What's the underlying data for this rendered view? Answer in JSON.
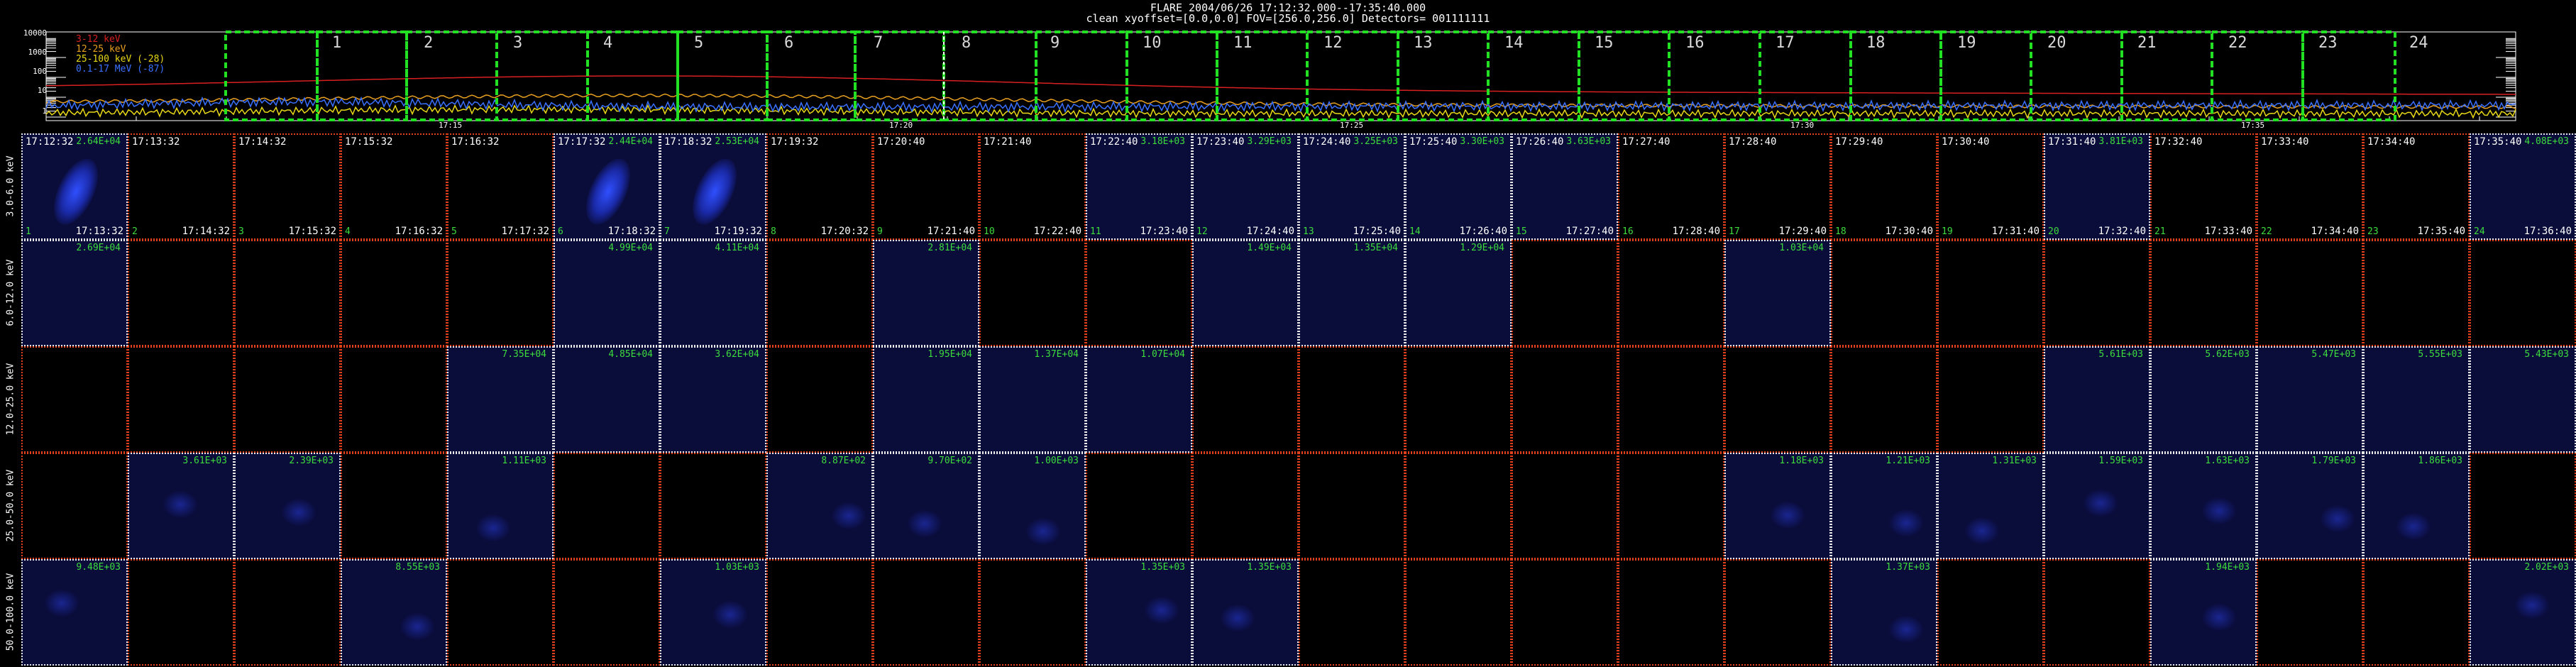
{
  "header": {
    "title": "FLARE 2004/06/26 17:12:32.000--17:35:40.000",
    "info": "clean   xyoffset=[0.0,0.0]   FOV=[256.0,256.0]   Detectors= 001111111"
  },
  "lightcurve": {
    "legend": [
      "3-12 keV",
      "12-25 keV",
      "25-100 keV (-28)",
      "0.1-17 MeV (-87)"
    ],
    "yticks": [
      "10000",
      "1000",
      "100",
      "10",
      "1"
    ],
    "xticks": [
      "17:15",
      "17:20",
      "17:25",
      "17:30",
      "17:35"
    ],
    "bins": [
      "1",
      "2",
      "3",
      "4",
      "5",
      "6",
      "7",
      "8",
      "9",
      "10",
      "11",
      "12",
      "13",
      "14",
      "15",
      "16",
      "17",
      "18",
      "19",
      "20",
      "21",
      "22",
      "23",
      "24"
    ],
    "colors": {
      "c1": "#d82020",
      "c2": "#e8a020",
      "c3": "#e8d818",
      "c4": "#3a70ff",
      "box": "#22e022"
    }
  },
  "energy_bands": [
    "3.0-6.0 keV",
    "6.0-12.0 keV",
    "12.0-25.0 keV",
    "25.0-50.0 keV",
    "50.0-100.0 keV"
  ],
  "columns": [
    {
      "idx": "1",
      "start": "17:12:32",
      "end": "17:13:32"
    },
    {
      "idx": "2",
      "start": "17:13:32",
      "end": "17:14:32"
    },
    {
      "idx": "3",
      "start": "17:14:32",
      "end": "17:15:32"
    },
    {
      "idx": "4",
      "start": "17:15:32",
      "end": "17:16:32"
    },
    {
      "idx": "5",
      "start": "17:16:32",
      "end": "17:17:32"
    },
    {
      "idx": "6",
      "start": "17:17:32",
      "end": "17:18:32"
    },
    {
      "idx": "7",
      "start": "17:18:32",
      "end": "17:19:32"
    },
    {
      "idx": "8",
      "start": "17:19:32",
      "end": "17:20:32"
    },
    {
      "idx": "9",
      "start": "17:20:40",
      "end": "17:21:40"
    },
    {
      "idx": "10",
      "start": "17:21:40",
      "end": "17:22:40"
    },
    {
      "idx": "11",
      "start": "17:22:40",
      "end": "17:23:40"
    },
    {
      "idx": "12",
      "start": "17:23:40",
      "end": "17:24:40"
    },
    {
      "idx": "13",
      "start": "17:24:40",
      "end": "17:25:40"
    },
    {
      "idx": "14",
      "start": "17:25:40",
      "end": "17:26:40"
    },
    {
      "idx": "15",
      "start": "17:26:40",
      "end": "17:27:40"
    },
    {
      "idx": "16",
      "start": "17:27:40",
      "end": "17:28:40"
    },
    {
      "idx": "17",
      "start": "17:28:40",
      "end": "17:29:40"
    },
    {
      "idx": "18",
      "start": "17:29:40",
      "end": "17:30:40"
    },
    {
      "idx": "19",
      "start": "17:30:40",
      "end": "17:31:40"
    },
    {
      "idx": "20",
      "start": "17:31:40",
      "end": "17:32:40"
    },
    {
      "idx": "21",
      "start": "17:32:40",
      "end": "17:33:40"
    },
    {
      "idx": "22",
      "start": "17:33:40",
      "end": "17:34:40"
    },
    {
      "idx": "23",
      "start": "17:34:40",
      "end": "17:35:40"
    },
    {
      "idx": "24",
      "start": "17:35:40",
      "end": "17:36:40"
    }
  ],
  "cells": [
    {
      "row": 0,
      "col": 0,
      "count": "2.64E+04",
      "flare": true
    },
    {
      "row": 0,
      "col": 5,
      "count": "2.44E+04",
      "flare": true
    },
    {
      "row": 0,
      "col": 6,
      "count": "2.53E+04",
      "flare": true
    },
    {
      "row": 0,
      "col": 10,
      "count": "3.18E+03"
    },
    {
      "row": 0,
      "col": 11,
      "count": "3.29E+03"
    },
    {
      "row": 0,
      "col": 12,
      "count": "3.25E+03"
    },
    {
      "row": 0,
      "col": 13,
      "count": "3.30E+03"
    },
    {
      "row": 0,
      "col": 14,
      "count": "3.63E+03"
    },
    {
      "row": 0,
      "col": 19,
      "count": "3.81E+03"
    },
    {
      "row": 0,
      "col": 23,
      "count": "4.08E+03"
    },
    {
      "row": 1,
      "col": 0,
      "count": "2.69E+04"
    },
    {
      "row": 1,
      "col": 5,
      "count": "4.99E+04"
    },
    {
      "row": 1,
      "col": 6,
      "count": "4.11E+04"
    },
    {
      "row": 1,
      "col": 8,
      "count": "2.81E+04"
    },
    {
      "row": 1,
      "col": 11,
      "count": "1.49E+04"
    },
    {
      "row": 1,
      "col": 12,
      "count": "1.35E+04"
    },
    {
      "row": 1,
      "col": 13,
      "count": "1.29E+04"
    },
    {
      "row": 1,
      "col": 16,
      "count": "1.03E+04"
    },
    {
      "row": 2,
      "col": 4,
      "count": "7.35E+04"
    },
    {
      "row": 2,
      "col": 5,
      "count": "4.85E+04"
    },
    {
      "row": 2,
      "col": 6,
      "count": "3.62E+04"
    },
    {
      "row": 2,
      "col": 8,
      "count": "1.95E+04"
    },
    {
      "row": 2,
      "col": 9,
      "count": "1.37E+04"
    },
    {
      "row": 2,
      "col": 10,
      "count": "1.07E+04"
    },
    {
      "row": 2,
      "col": 19,
      "count": "5.61E+03"
    },
    {
      "row": 2,
      "col": 20,
      "count": "5.62E+03"
    },
    {
      "row": 2,
      "col": 21,
      "count": "5.47E+03"
    },
    {
      "row": 2,
      "col": 22,
      "count": "5.55E+03"
    },
    {
      "row": 2,
      "col": 23,
      "count": "5.43E+03"
    },
    {
      "row": 3,
      "col": 1,
      "count": "3.61E+03"
    },
    {
      "row": 3,
      "col": 2,
      "count": "2.39E+03"
    },
    {
      "row": 3,
      "col": 4,
      "count": "1.11E+03"
    },
    {
      "row": 3,
      "col": 7,
      "count": "8.87E+02"
    },
    {
      "row": 3,
      "col": 8,
      "count": "9.70E+02"
    },
    {
      "row": 3,
      "col": 9,
      "count": "1.00E+03"
    },
    {
      "row": 3,
      "col": 16,
      "count": "1.18E+03"
    },
    {
      "row": 3,
      "col": 17,
      "count": "1.21E+03"
    },
    {
      "row": 3,
      "col": 18,
      "count": "1.31E+03"
    },
    {
      "row": 3,
      "col": 19,
      "count": "1.59E+03"
    },
    {
      "row": 3,
      "col": 20,
      "count": "1.63E+03"
    },
    {
      "row": 3,
      "col": 21,
      "count": "1.79E+03"
    },
    {
      "row": 3,
      "col": 22,
      "count": "1.86E+03"
    },
    {
      "row": 4,
      "col": 0,
      "count": "9.48E+03"
    },
    {
      "row": 4,
      "col": 3,
      "count": "8.55E+03"
    },
    {
      "row": 4,
      "col": 6,
      "count": "1.03E+03"
    },
    {
      "row": 4,
      "col": 10,
      "count": "1.35E+03"
    },
    {
      "row": 4,
      "col": 11,
      "count": "1.35E+03"
    },
    {
      "row": 4,
      "col": 17,
      "count": "1.37E+03"
    },
    {
      "row": 4,
      "col": 20,
      "count": "1.94E+03"
    },
    {
      "row": 4,
      "col": 23,
      "count": "2.02E+03"
    }
  ]
}
